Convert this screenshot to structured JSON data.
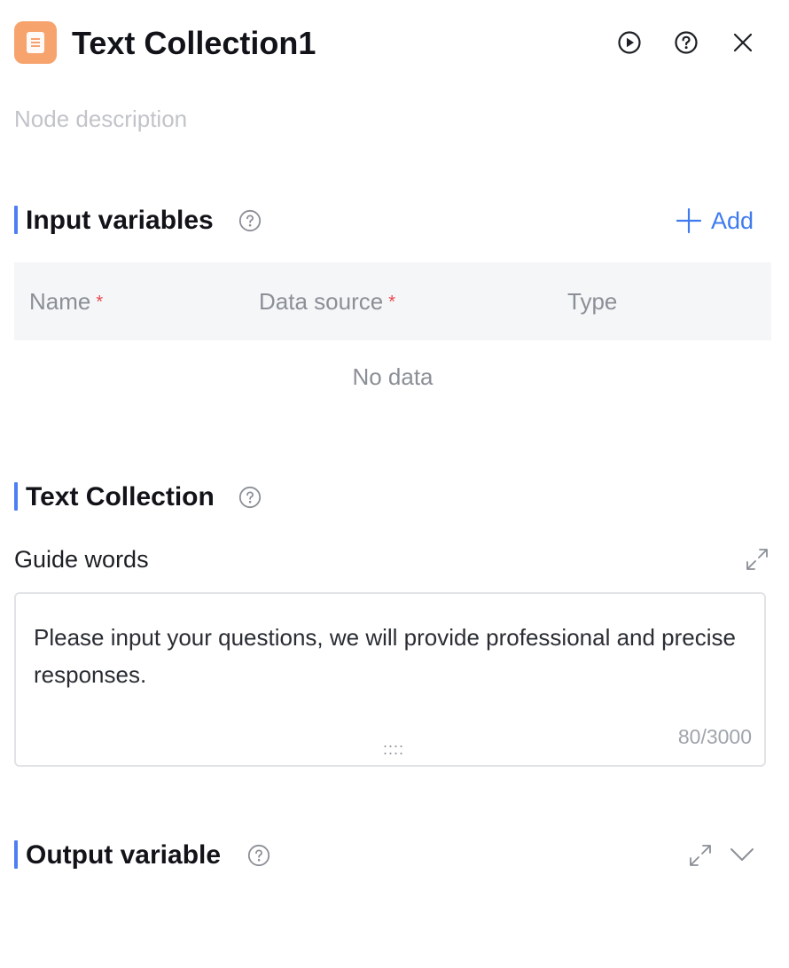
{
  "header": {
    "title": "Text Collection1",
    "icon": "document-icon",
    "icon_color": "#f7a36e",
    "actions": [
      "play-icon",
      "help-icon",
      "close-icon"
    ]
  },
  "description": {
    "placeholder": "Node description"
  },
  "input_variables": {
    "title": "Input variables",
    "add_label": "Add",
    "columns": [
      {
        "label": "Name",
        "required": "*"
      },
      {
        "label": "Data source",
        "required": "*"
      },
      {
        "label": "Type",
        "required": ""
      }
    ],
    "empty_text": "No data"
  },
  "text_collection": {
    "title": "Text Collection",
    "guide_label": "Guide words",
    "guide_value": "Please input your questions, we will provide professional and precise responses.",
    "counter": "80/3000",
    "resize_glyph": "::::"
  },
  "output_variable": {
    "title": "Output variable"
  },
  "colors": {
    "accent": "#3f7bf0",
    "section_bar": "#4d7ff3",
    "required": "#e8474d"
  }
}
